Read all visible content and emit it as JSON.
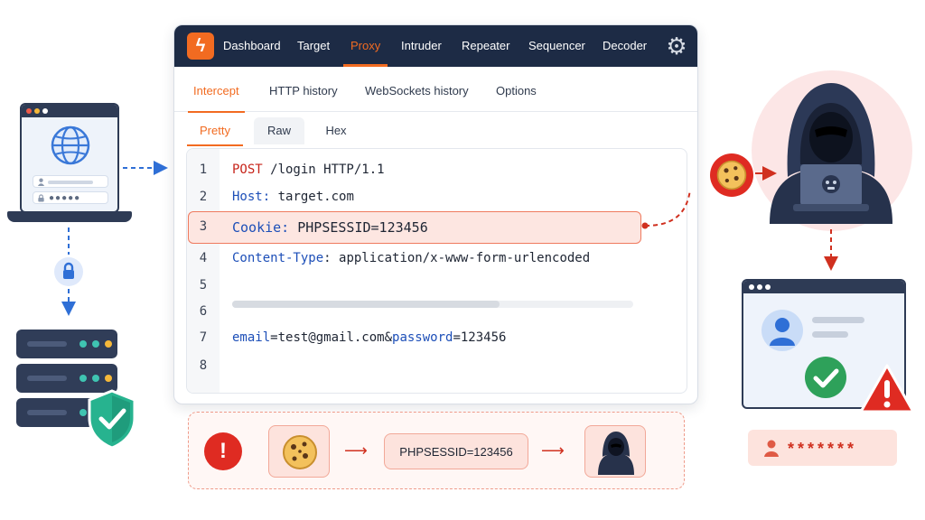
{
  "colors": {
    "accent": "#f26b21",
    "navy": "#1d2b45",
    "alert_red": "#df2b22",
    "success_green": "#2ea15a",
    "highlight_bg": "#fde6e1"
  },
  "topbar": {
    "logo_icon": "lightning-icon",
    "nav": [
      "Dashboard",
      "Target",
      "Proxy",
      "Intruder",
      "Repeater",
      "Sequencer",
      "Decoder"
    ],
    "active_nav": "Proxy",
    "settings_icon": "gear-icon"
  },
  "subtabs": {
    "items": [
      "Intercept",
      "HTTP history",
      "WebSockets history",
      "Options"
    ],
    "active": "Intercept"
  },
  "view_tabs": {
    "items": [
      "Pretty",
      "Raw",
      "Hex"
    ],
    "active": "Pretty"
  },
  "request": {
    "line_numbers": [
      "1",
      "2",
      "3",
      "4",
      "5",
      "6",
      "7",
      "8"
    ],
    "method": "POST",
    "request_line_rest": " /login HTTP/1.1",
    "host_key": "Host:",
    "host_value": " target.com",
    "cookie_key": "Cookie:",
    "cookie_value": " PHPSESSID=123456",
    "content_type_key": "Content-Type",
    "content_type_value": ": application/x-www-form-urlencoded",
    "body_email_key": "email",
    "body_email_value": "=test@gmail.com&",
    "body_password_key": "password",
    "body_password_value": "=123456",
    "highlighted_line": "3"
  },
  "flow": {
    "alert_glyph": "!",
    "stolen_session": "PHPSESSID=123456"
  },
  "victim": {
    "password_mask": "*******",
    "alert_glyph": "!"
  }
}
